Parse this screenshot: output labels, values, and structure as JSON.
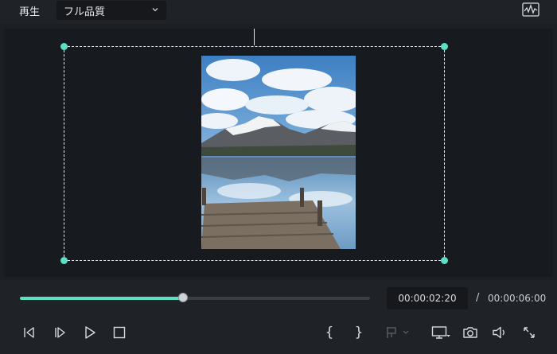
{
  "topbar": {
    "play_label": "再生",
    "quality_value": "フル品質"
  },
  "playback": {
    "progress": 0.465,
    "current_time": "00:00:02:20",
    "separator": "/",
    "total_time": "00:00:06:00"
  },
  "icons": {
    "prev_frame": "previous-frame-icon",
    "next_frame": "next-frame-icon",
    "play": "play-icon",
    "stop": "stop-icon",
    "mark_in": "mark-in-icon",
    "mark_out": "mark-out-icon",
    "marker": "marker-icon",
    "display": "display-icon",
    "snapshot": "camera-icon",
    "volume": "volume-icon",
    "fullscreen": "fullscreen-icon",
    "waveform": "waveform-icon"
  },
  "colors": {
    "accent": "#5ce0c4",
    "background": "#1c1f24",
    "preview_bg": "#171a1e"
  }
}
